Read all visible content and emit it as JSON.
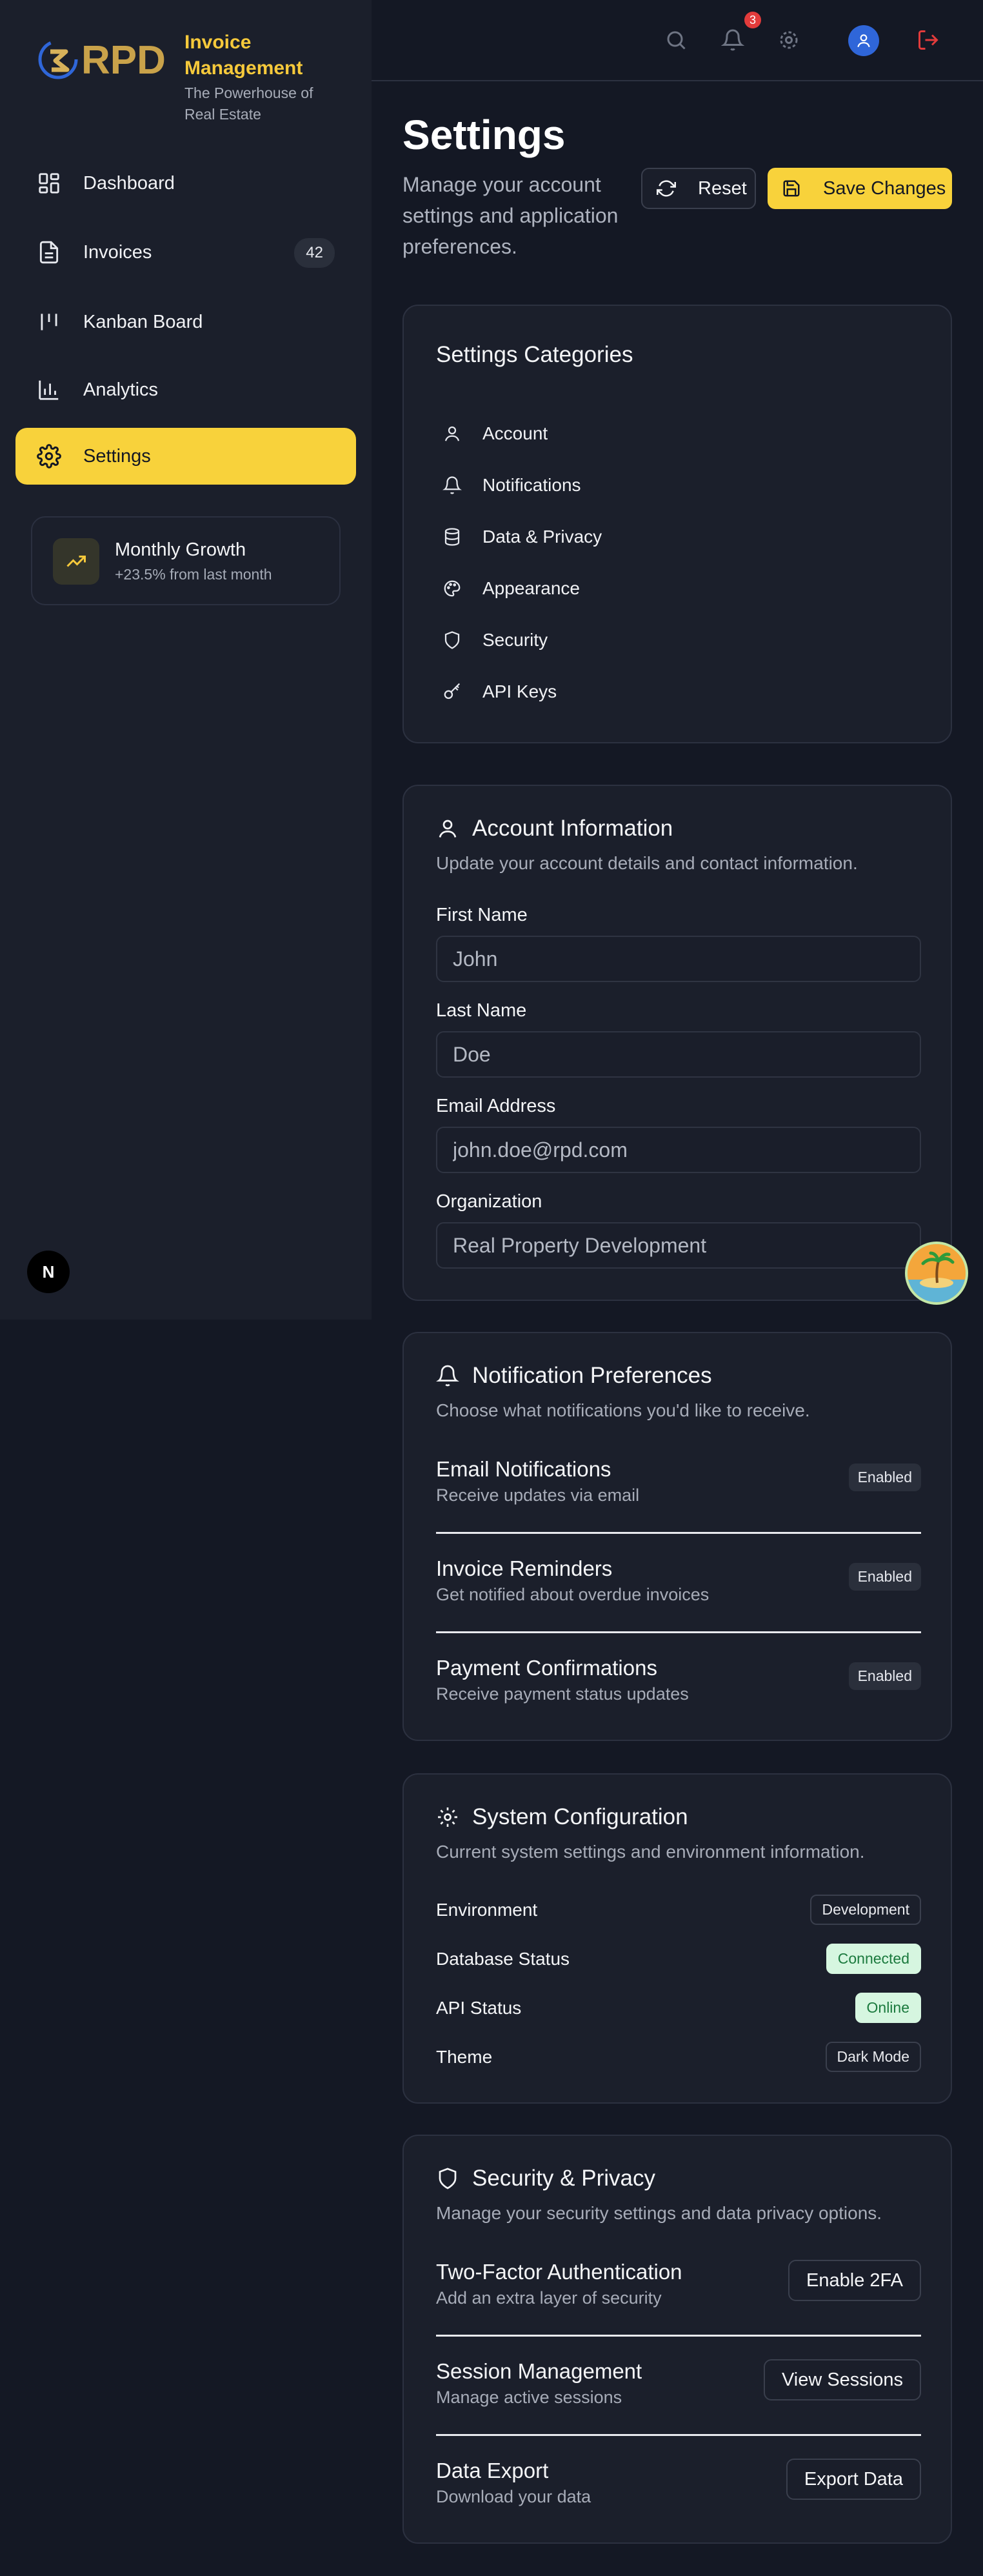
{
  "brand": {
    "logo_text": "RPD",
    "title": "Invoice Management",
    "subtitle": "The Powerhouse of Real Estate"
  },
  "sidebar": {
    "items": [
      {
        "label": "Dashboard",
        "icon": "dashboard-icon"
      },
      {
        "label": "Invoices",
        "icon": "file-text-icon",
        "badge": "42"
      },
      {
        "label": "Kanban Board",
        "icon": "kanban-icon"
      },
      {
        "label": "Analytics",
        "icon": "bar-chart-icon"
      },
      {
        "label": "Settings",
        "icon": "gear-icon",
        "active": true
      }
    ],
    "growth": {
      "title": "Monthly Growth",
      "subtitle": "+23.5% from last month",
      "icon": "trending-up-icon"
    },
    "next_badge": "N"
  },
  "topbar": {
    "notification_count": "3",
    "icons": [
      "search-icon",
      "bell-icon",
      "gear-icon",
      "user-icon",
      "logout-icon"
    ]
  },
  "header": {
    "title": "Settings",
    "description": "Manage your account settings and application preferences.",
    "reset_label": "Reset",
    "save_label": "Save Changes"
  },
  "categories": {
    "title": "Settings Categories",
    "items": [
      {
        "label": "Account",
        "icon": "user-icon"
      },
      {
        "label": "Notifications",
        "icon": "bell-icon"
      },
      {
        "label": "Data & Privacy",
        "icon": "database-icon"
      },
      {
        "label": "Appearance",
        "icon": "palette-icon"
      },
      {
        "label": "Security",
        "icon": "shield-icon"
      },
      {
        "label": "API Keys",
        "icon": "key-icon"
      }
    ]
  },
  "account": {
    "title": "Account Information",
    "subtitle": "Update your account details and contact information.",
    "fields": [
      {
        "label": "First Name",
        "value": "John"
      },
      {
        "label": "Last Name",
        "value": "Doe"
      },
      {
        "label": "Email Address",
        "value": "john.doe@rpd.com"
      },
      {
        "label": "Organization",
        "value": "Real Property Development"
      }
    ]
  },
  "notifications": {
    "title": "Notification Preferences",
    "subtitle": "Choose what notifications you'd like to receive.",
    "items": [
      {
        "title": "Email Notifications",
        "desc": "Receive updates via email",
        "status": "Enabled"
      },
      {
        "title": "Invoice Reminders",
        "desc": "Get notified about overdue invoices",
        "status": "Enabled"
      },
      {
        "title": "Payment Confirmations",
        "desc": "Receive payment status updates",
        "status": "Enabled"
      }
    ]
  },
  "system": {
    "title": "System Configuration",
    "subtitle": "Current system settings and environment information.",
    "rows": [
      {
        "label": "Environment",
        "value": "Development",
        "color": "#e9eaee"
      },
      {
        "label": "Database Status",
        "value": "Connected",
        "color": "#1b7a3e"
      },
      {
        "label": "API Status",
        "value": "Online",
        "color": "#1b7a3e"
      },
      {
        "label": "Theme",
        "value": "Dark Mode",
        "color": "#e9eaee"
      }
    ]
  },
  "security": {
    "title": "Security & Privacy",
    "subtitle": "Manage your security settings and data privacy options.",
    "items": [
      {
        "title": "Two-Factor Authentication",
        "desc": "Add an extra layer of security",
        "button": "Enable 2FA"
      },
      {
        "title": "Session Management",
        "desc": "Manage active sessions",
        "button": "View Sessions"
      },
      {
        "title": "Data Export",
        "desc": "Download your data",
        "button": "Export Data"
      }
    ]
  },
  "colors": {
    "background": "#141824",
    "surface": "#1b1f2b",
    "accent": "#f8d23b",
    "brand_gold": "#c9a24a",
    "danger": "#e23b3b",
    "avatar_blue": "#2f66d9"
  }
}
